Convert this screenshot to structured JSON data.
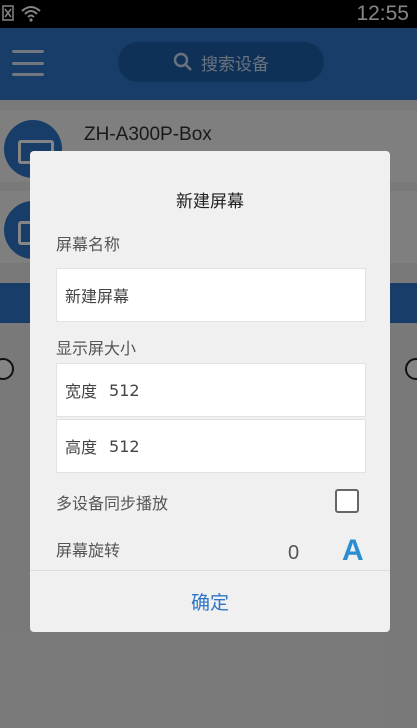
{
  "status_bar": {
    "time": "12:55"
  },
  "app_bar": {
    "search_placeholder": "搜索设备"
  },
  "devices": [
    {
      "name": "ZH-A300P-Box"
    }
  ],
  "dialog": {
    "title": "新建屏幕",
    "screen_name_label": "屏幕名称",
    "screen_name_value": "新建屏幕",
    "display_size_label": "显示屏大小",
    "width_label": "宽度",
    "width_value": "512",
    "height_label": "高度",
    "height_value": "512",
    "sync_label": "多设备同步播放",
    "sync_checked": false,
    "rotate_label": "屏幕旋转",
    "rotate_value": "0",
    "rotate_icon_glyph": "A",
    "confirm_label": "确定"
  },
  "colors": {
    "accent": "#2e76c8",
    "rotate_icon": "#2a8ed0"
  }
}
